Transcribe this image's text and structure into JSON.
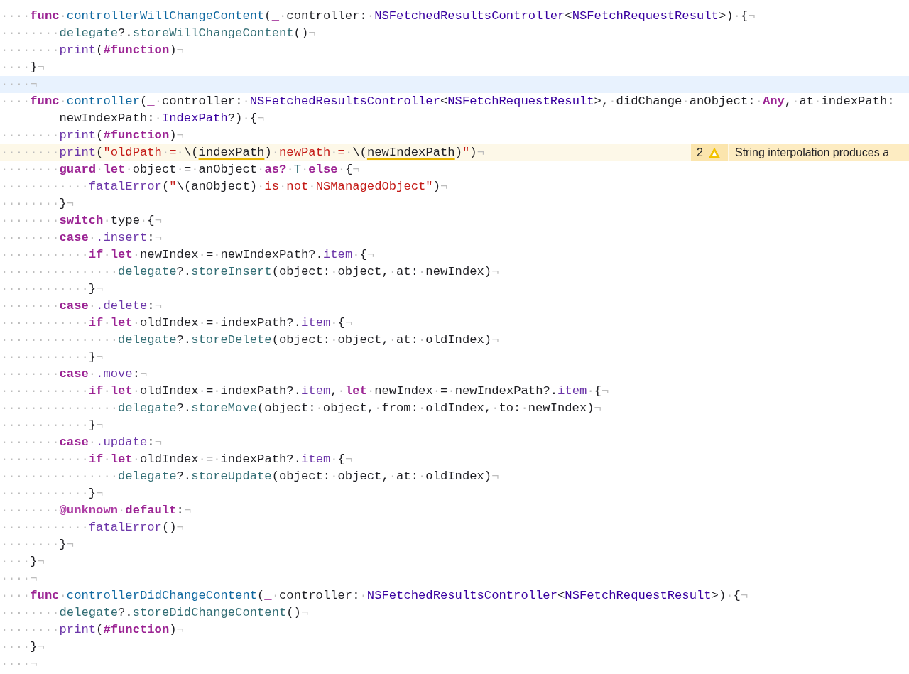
{
  "editor": {
    "lines": [
      {
        "current": false,
        "continuation": false,
        "tokens": [
          {
            "kind": "w",
            "text": "····"
          },
          {
            "kind": "k",
            "text": "func"
          },
          {
            "kind": "w",
            "text": "·"
          },
          {
            "kind": "d",
            "text": "controllerWillChangeContent"
          },
          {
            "kind": "p",
            "text": "("
          },
          {
            "kind": "k",
            "text": "_"
          },
          {
            "kind": "w",
            "text": "·"
          },
          {
            "kind": "p",
            "text": "controller:"
          },
          {
            "kind": "w",
            "text": "·"
          },
          {
            "kind": "st",
            "text": "NSFetchedResultsController"
          },
          {
            "kind": "p",
            "text": "<"
          },
          {
            "kind": "st",
            "text": "NSFetchRequestResult"
          },
          {
            "kind": "p",
            "text": ">)"
          },
          {
            "kind": "w",
            "text": "·"
          },
          {
            "kind": "p",
            "text": "{"
          },
          {
            "kind": "w",
            "text": "¬"
          }
        ]
      },
      {
        "current": false,
        "continuation": false,
        "tokens": [
          {
            "kind": "w",
            "text": "········"
          },
          {
            "kind": "pf",
            "text": "delegate"
          },
          {
            "kind": "p",
            "text": "?."
          },
          {
            "kind": "pf",
            "text": "storeWillChangeContent"
          },
          {
            "kind": "p",
            "text": "()"
          },
          {
            "kind": "w",
            "text": "¬"
          }
        ]
      },
      {
        "current": false,
        "continuation": false,
        "tokens": [
          {
            "kind": "w",
            "text": "········"
          },
          {
            "kind": "sf",
            "text": "print"
          },
          {
            "kind": "p",
            "text": "("
          },
          {
            "kind": "k",
            "text": "#function"
          },
          {
            "kind": "p",
            "text": ")"
          },
          {
            "kind": "w",
            "text": "¬"
          }
        ]
      },
      {
        "current": false,
        "continuation": false,
        "tokens": [
          {
            "kind": "w",
            "text": "····"
          },
          {
            "kind": "p",
            "text": "}"
          },
          {
            "kind": "w",
            "text": "¬"
          }
        ]
      },
      {
        "current": true,
        "continuation": false,
        "tokens": [
          {
            "kind": "w",
            "text": "····¬"
          }
        ]
      },
      {
        "current": false,
        "continuation": false,
        "tokens": [
          {
            "kind": "w",
            "text": "····"
          },
          {
            "kind": "k",
            "text": "func"
          },
          {
            "kind": "w",
            "text": "·"
          },
          {
            "kind": "d",
            "text": "controller"
          },
          {
            "kind": "p",
            "text": "("
          },
          {
            "kind": "k",
            "text": "_"
          },
          {
            "kind": "w",
            "text": "·"
          },
          {
            "kind": "p",
            "text": "controller:"
          },
          {
            "kind": "w",
            "text": "·"
          },
          {
            "kind": "st",
            "text": "NSFetchedResultsController"
          },
          {
            "kind": "p",
            "text": "<"
          },
          {
            "kind": "st",
            "text": "NSFetchRequestResult"
          },
          {
            "kind": "p",
            "text": ">,"
          },
          {
            "kind": "w",
            "text": "·"
          },
          {
            "kind": "p",
            "text": "didChange"
          },
          {
            "kind": "w",
            "text": "·"
          },
          {
            "kind": "p",
            "text": "anObject:"
          },
          {
            "kind": "w",
            "text": "·"
          },
          {
            "kind": "k",
            "text": "Any"
          },
          {
            "kind": "p",
            "text": ","
          },
          {
            "kind": "w",
            "text": "·"
          },
          {
            "kind": "p",
            "text": "at"
          },
          {
            "kind": "w",
            "text": "·"
          },
          {
            "kind": "p",
            "text": "indexPath:"
          }
        ]
      },
      {
        "current": false,
        "continuation": true,
        "tokens": [
          {
            "kind": "p",
            "text": "newIndexPath:"
          },
          {
            "kind": "w",
            "text": "·"
          },
          {
            "kind": "st",
            "text": "IndexPath"
          },
          {
            "kind": "p",
            "text": "?)"
          },
          {
            "kind": "w",
            "text": "·"
          },
          {
            "kind": "p",
            "text": "{"
          },
          {
            "kind": "w",
            "text": "¬"
          }
        ]
      },
      {
        "current": false,
        "continuation": false,
        "tokens": [
          {
            "kind": "w",
            "text": "········"
          },
          {
            "kind": "sf",
            "text": "print"
          },
          {
            "kind": "p",
            "text": "("
          },
          {
            "kind": "k",
            "text": "#function"
          },
          {
            "kind": "p",
            "text": ")"
          },
          {
            "kind": "w",
            "text": "¬"
          }
        ]
      },
      {
        "current": false,
        "continuation": false,
        "warning": {
          "count": "2",
          "message": "String interpolation produces a"
        },
        "tokens": [
          {
            "kind": "w",
            "text": "········"
          },
          {
            "kind": "sf",
            "text": "print"
          },
          {
            "kind": "p",
            "text": "("
          },
          {
            "kind": "s",
            "text": "\"oldPath"
          },
          {
            "kind": "w",
            "text": "·"
          },
          {
            "kind": "s",
            "text": "="
          },
          {
            "kind": "w",
            "text": "·"
          },
          {
            "kind": "p",
            "text": "\\("
          },
          {
            "kind": "u",
            "text": "indexPath"
          },
          {
            "kind": "p",
            "text": ")"
          },
          {
            "kind": "w",
            "text": "·"
          },
          {
            "kind": "s",
            "text": "newPath"
          },
          {
            "kind": "w",
            "text": "·"
          },
          {
            "kind": "s",
            "text": "="
          },
          {
            "kind": "w",
            "text": "·"
          },
          {
            "kind": "p",
            "text": "\\("
          },
          {
            "kind": "u",
            "text": "newIndexPath"
          },
          {
            "kind": "p",
            "text": ")"
          },
          {
            "kind": "s",
            "text": "\""
          },
          {
            "kind": "p",
            "text": ")"
          },
          {
            "kind": "w",
            "text": "¬"
          }
        ]
      },
      {
        "current": false,
        "continuation": false,
        "tokens": [
          {
            "kind": "w",
            "text": "········"
          },
          {
            "kind": "k",
            "text": "guard"
          },
          {
            "kind": "w",
            "text": "·"
          },
          {
            "kind": "k",
            "text": "let"
          },
          {
            "kind": "w",
            "text": "·"
          },
          {
            "kind": "p",
            "text": "object"
          },
          {
            "kind": "w",
            "text": "·"
          },
          {
            "kind": "p",
            "text": "="
          },
          {
            "kind": "w",
            "text": "·"
          },
          {
            "kind": "p",
            "text": "anObject"
          },
          {
            "kind": "w",
            "text": "·"
          },
          {
            "kind": "k",
            "text": "as?"
          },
          {
            "kind": "w",
            "text": "·"
          },
          {
            "kind": "pf",
            "text": "T"
          },
          {
            "kind": "w",
            "text": "·"
          },
          {
            "kind": "k",
            "text": "else"
          },
          {
            "kind": "w",
            "text": "·"
          },
          {
            "kind": "p",
            "text": "{"
          },
          {
            "kind": "w",
            "text": "¬"
          }
        ]
      },
      {
        "current": false,
        "continuation": false,
        "tokens": [
          {
            "kind": "w",
            "text": "············"
          },
          {
            "kind": "sf",
            "text": "fatalError"
          },
          {
            "kind": "p",
            "text": "("
          },
          {
            "kind": "s",
            "text": "\""
          },
          {
            "kind": "p",
            "text": "\\(anObject)"
          },
          {
            "kind": "w",
            "text": "·"
          },
          {
            "kind": "s",
            "text": "is"
          },
          {
            "kind": "w",
            "text": "·"
          },
          {
            "kind": "s",
            "text": "not"
          },
          {
            "kind": "w",
            "text": "·"
          },
          {
            "kind": "s",
            "text": "NSManagedObject\""
          },
          {
            "kind": "p",
            "text": ")"
          },
          {
            "kind": "w",
            "text": "¬"
          }
        ]
      },
      {
        "current": false,
        "continuation": false,
        "tokens": [
          {
            "kind": "w",
            "text": "········"
          },
          {
            "kind": "p",
            "text": "}"
          },
          {
            "kind": "w",
            "text": "¬"
          }
        ]
      },
      {
        "current": false,
        "continuation": false,
        "tokens": [
          {
            "kind": "w",
            "text": "········"
          },
          {
            "kind": "k",
            "text": "switch"
          },
          {
            "kind": "w",
            "text": "·"
          },
          {
            "kind": "p",
            "text": "type"
          },
          {
            "kind": "w",
            "text": "·"
          },
          {
            "kind": "p",
            "text": "{"
          },
          {
            "kind": "w",
            "text": "¬"
          }
        ]
      },
      {
        "current": false,
        "continuation": false,
        "tokens": [
          {
            "kind": "w",
            "text": "········"
          },
          {
            "kind": "k",
            "text": "case"
          },
          {
            "kind": "w",
            "text": "·"
          },
          {
            "kind": "sf",
            "text": ".insert"
          },
          {
            "kind": "p",
            "text": ":"
          },
          {
            "kind": "w",
            "text": "¬"
          }
        ]
      },
      {
        "current": false,
        "continuation": false,
        "tokens": [
          {
            "kind": "w",
            "text": "············"
          },
          {
            "kind": "k",
            "text": "if"
          },
          {
            "kind": "w",
            "text": "·"
          },
          {
            "kind": "k",
            "text": "let"
          },
          {
            "kind": "w",
            "text": "·"
          },
          {
            "kind": "p",
            "text": "newIndex"
          },
          {
            "kind": "w",
            "text": "·"
          },
          {
            "kind": "p",
            "text": "="
          },
          {
            "kind": "w",
            "text": "·"
          },
          {
            "kind": "p",
            "text": "newIndexPath?."
          },
          {
            "kind": "sf",
            "text": "item"
          },
          {
            "kind": "w",
            "text": "·"
          },
          {
            "kind": "p",
            "text": "{"
          },
          {
            "kind": "w",
            "text": "¬"
          }
        ]
      },
      {
        "current": false,
        "continuation": false,
        "tokens": [
          {
            "kind": "w",
            "text": "················"
          },
          {
            "kind": "pf",
            "text": "delegate"
          },
          {
            "kind": "p",
            "text": "?."
          },
          {
            "kind": "pf",
            "text": "storeInsert"
          },
          {
            "kind": "p",
            "text": "(object:"
          },
          {
            "kind": "w",
            "text": "·"
          },
          {
            "kind": "p",
            "text": "object,"
          },
          {
            "kind": "w",
            "text": "·"
          },
          {
            "kind": "p",
            "text": "at:"
          },
          {
            "kind": "w",
            "text": "·"
          },
          {
            "kind": "p",
            "text": "newIndex)"
          },
          {
            "kind": "w",
            "text": "¬"
          }
        ]
      },
      {
        "current": false,
        "continuation": false,
        "tokens": [
          {
            "kind": "w",
            "text": "············"
          },
          {
            "kind": "p",
            "text": "}"
          },
          {
            "kind": "w",
            "text": "¬"
          }
        ]
      },
      {
        "current": false,
        "continuation": false,
        "tokens": [
          {
            "kind": "w",
            "text": "········"
          },
          {
            "kind": "k",
            "text": "case"
          },
          {
            "kind": "w",
            "text": "·"
          },
          {
            "kind": "sf",
            "text": ".delete"
          },
          {
            "kind": "p",
            "text": ":"
          },
          {
            "kind": "w",
            "text": "¬"
          }
        ]
      },
      {
        "current": false,
        "continuation": false,
        "tokens": [
          {
            "kind": "w",
            "text": "············"
          },
          {
            "kind": "k",
            "text": "if"
          },
          {
            "kind": "w",
            "text": "·"
          },
          {
            "kind": "k",
            "text": "let"
          },
          {
            "kind": "w",
            "text": "·"
          },
          {
            "kind": "p",
            "text": "oldIndex"
          },
          {
            "kind": "w",
            "text": "·"
          },
          {
            "kind": "p",
            "text": "="
          },
          {
            "kind": "w",
            "text": "·"
          },
          {
            "kind": "p",
            "text": "indexPath?."
          },
          {
            "kind": "sf",
            "text": "item"
          },
          {
            "kind": "w",
            "text": "·"
          },
          {
            "kind": "p",
            "text": "{"
          },
          {
            "kind": "w",
            "text": "¬"
          }
        ]
      },
      {
        "current": false,
        "continuation": false,
        "tokens": [
          {
            "kind": "w",
            "text": "················"
          },
          {
            "kind": "pf",
            "text": "delegate"
          },
          {
            "kind": "p",
            "text": "?."
          },
          {
            "kind": "pf",
            "text": "storeDelete"
          },
          {
            "kind": "p",
            "text": "(object:"
          },
          {
            "kind": "w",
            "text": "·"
          },
          {
            "kind": "p",
            "text": "object,"
          },
          {
            "kind": "w",
            "text": "·"
          },
          {
            "kind": "p",
            "text": "at:"
          },
          {
            "kind": "w",
            "text": "·"
          },
          {
            "kind": "p",
            "text": "oldIndex)"
          },
          {
            "kind": "w",
            "text": "¬"
          }
        ]
      },
      {
        "current": false,
        "continuation": false,
        "tokens": [
          {
            "kind": "w",
            "text": "············"
          },
          {
            "kind": "p",
            "text": "}"
          },
          {
            "kind": "w",
            "text": "¬"
          }
        ]
      },
      {
        "current": false,
        "continuation": false,
        "tokens": [
          {
            "kind": "w",
            "text": "········"
          },
          {
            "kind": "k",
            "text": "case"
          },
          {
            "kind": "w",
            "text": "·"
          },
          {
            "kind": "sf",
            "text": ".move"
          },
          {
            "kind": "p",
            "text": ":"
          },
          {
            "kind": "w",
            "text": "¬"
          }
        ]
      },
      {
        "current": false,
        "continuation": false,
        "tokens": [
          {
            "kind": "w",
            "text": "············"
          },
          {
            "kind": "k",
            "text": "if"
          },
          {
            "kind": "w",
            "text": "·"
          },
          {
            "kind": "k",
            "text": "let"
          },
          {
            "kind": "w",
            "text": "·"
          },
          {
            "kind": "p",
            "text": "oldIndex"
          },
          {
            "kind": "w",
            "text": "·"
          },
          {
            "kind": "p",
            "text": "="
          },
          {
            "kind": "w",
            "text": "·"
          },
          {
            "kind": "p",
            "text": "indexPath?."
          },
          {
            "kind": "sf",
            "text": "item"
          },
          {
            "kind": "p",
            "text": ","
          },
          {
            "kind": "w",
            "text": "·"
          },
          {
            "kind": "k",
            "text": "let"
          },
          {
            "kind": "w",
            "text": "·"
          },
          {
            "kind": "p",
            "text": "newIndex"
          },
          {
            "kind": "w",
            "text": "·"
          },
          {
            "kind": "p",
            "text": "="
          },
          {
            "kind": "w",
            "text": "·"
          },
          {
            "kind": "p",
            "text": "newIndexPath?."
          },
          {
            "kind": "sf",
            "text": "item"
          },
          {
            "kind": "w",
            "text": "·"
          },
          {
            "kind": "p",
            "text": "{"
          },
          {
            "kind": "w",
            "text": "¬"
          }
        ]
      },
      {
        "current": false,
        "continuation": false,
        "tokens": [
          {
            "kind": "w",
            "text": "················"
          },
          {
            "kind": "pf",
            "text": "delegate"
          },
          {
            "kind": "p",
            "text": "?."
          },
          {
            "kind": "pf",
            "text": "storeMove"
          },
          {
            "kind": "p",
            "text": "(object:"
          },
          {
            "kind": "w",
            "text": "·"
          },
          {
            "kind": "p",
            "text": "object,"
          },
          {
            "kind": "w",
            "text": "·"
          },
          {
            "kind": "p",
            "text": "from:"
          },
          {
            "kind": "w",
            "text": "·"
          },
          {
            "kind": "p",
            "text": "oldIndex,"
          },
          {
            "kind": "w",
            "text": "·"
          },
          {
            "kind": "p",
            "text": "to:"
          },
          {
            "kind": "w",
            "text": "·"
          },
          {
            "kind": "p",
            "text": "newIndex)"
          },
          {
            "kind": "w",
            "text": "¬"
          }
        ]
      },
      {
        "current": false,
        "continuation": false,
        "tokens": [
          {
            "kind": "w",
            "text": "············"
          },
          {
            "kind": "p",
            "text": "}"
          },
          {
            "kind": "w",
            "text": "¬"
          }
        ]
      },
      {
        "current": false,
        "continuation": false,
        "tokens": [
          {
            "kind": "w",
            "text": "········"
          },
          {
            "kind": "k",
            "text": "case"
          },
          {
            "kind": "w",
            "text": "·"
          },
          {
            "kind": "sf",
            "text": ".update"
          },
          {
            "kind": "p",
            "text": ":"
          },
          {
            "kind": "w",
            "text": "¬"
          }
        ]
      },
      {
        "current": false,
        "continuation": false,
        "tokens": [
          {
            "kind": "w",
            "text": "············"
          },
          {
            "kind": "k",
            "text": "if"
          },
          {
            "kind": "w",
            "text": "·"
          },
          {
            "kind": "k",
            "text": "let"
          },
          {
            "kind": "w",
            "text": "·"
          },
          {
            "kind": "p",
            "text": "oldIndex"
          },
          {
            "kind": "w",
            "text": "·"
          },
          {
            "kind": "p",
            "text": "="
          },
          {
            "kind": "w",
            "text": "·"
          },
          {
            "kind": "p",
            "text": "indexPath?."
          },
          {
            "kind": "sf",
            "text": "item"
          },
          {
            "kind": "w",
            "text": "·"
          },
          {
            "kind": "p",
            "text": "{"
          },
          {
            "kind": "w",
            "text": "¬"
          }
        ]
      },
      {
        "current": false,
        "continuation": false,
        "tokens": [
          {
            "kind": "w",
            "text": "················"
          },
          {
            "kind": "pf",
            "text": "delegate"
          },
          {
            "kind": "p",
            "text": "?."
          },
          {
            "kind": "pf",
            "text": "storeUpdate"
          },
          {
            "kind": "p",
            "text": "(object:"
          },
          {
            "kind": "w",
            "text": "·"
          },
          {
            "kind": "p",
            "text": "object,"
          },
          {
            "kind": "w",
            "text": "·"
          },
          {
            "kind": "p",
            "text": "at:"
          },
          {
            "kind": "w",
            "text": "·"
          },
          {
            "kind": "p",
            "text": "oldIndex)"
          },
          {
            "kind": "w",
            "text": "¬"
          }
        ]
      },
      {
        "current": false,
        "continuation": false,
        "tokens": [
          {
            "kind": "w",
            "text": "············"
          },
          {
            "kind": "p",
            "text": "}"
          },
          {
            "kind": "w",
            "text": "¬"
          }
        ]
      },
      {
        "current": false,
        "continuation": false,
        "tokens": [
          {
            "kind": "w",
            "text": "········"
          },
          {
            "kind": "a",
            "text": "@unknown"
          },
          {
            "kind": "w",
            "text": "·"
          },
          {
            "kind": "k",
            "text": "default"
          },
          {
            "kind": "p",
            "text": ":"
          },
          {
            "kind": "w",
            "text": "¬"
          }
        ]
      },
      {
        "current": false,
        "continuation": false,
        "tokens": [
          {
            "kind": "w",
            "text": "············"
          },
          {
            "kind": "sf",
            "text": "fatalError"
          },
          {
            "kind": "p",
            "text": "()"
          },
          {
            "kind": "w",
            "text": "¬"
          }
        ]
      },
      {
        "current": false,
        "continuation": false,
        "tokens": [
          {
            "kind": "w",
            "text": "········"
          },
          {
            "kind": "p",
            "text": "}"
          },
          {
            "kind": "w",
            "text": "¬"
          }
        ]
      },
      {
        "current": false,
        "continuation": false,
        "tokens": [
          {
            "kind": "w",
            "text": "····"
          },
          {
            "kind": "p",
            "text": "}"
          },
          {
            "kind": "w",
            "text": "¬"
          }
        ]
      },
      {
        "current": false,
        "continuation": false,
        "tokens": [
          {
            "kind": "w",
            "text": "····¬"
          }
        ]
      },
      {
        "current": false,
        "continuation": false,
        "tokens": [
          {
            "kind": "w",
            "text": "····"
          },
          {
            "kind": "k",
            "text": "func"
          },
          {
            "kind": "w",
            "text": "·"
          },
          {
            "kind": "d",
            "text": "controllerDidChangeContent"
          },
          {
            "kind": "p",
            "text": "("
          },
          {
            "kind": "k",
            "text": "_"
          },
          {
            "kind": "w",
            "text": "·"
          },
          {
            "kind": "p",
            "text": "controller:"
          },
          {
            "kind": "w",
            "text": "·"
          },
          {
            "kind": "st",
            "text": "NSFetchedResultsController"
          },
          {
            "kind": "p",
            "text": "<"
          },
          {
            "kind": "st",
            "text": "NSFetchRequestResult"
          },
          {
            "kind": "p",
            "text": ">)"
          },
          {
            "kind": "w",
            "text": "·"
          },
          {
            "kind": "p",
            "text": "{"
          },
          {
            "kind": "w",
            "text": "¬"
          }
        ]
      },
      {
        "current": false,
        "continuation": false,
        "tokens": [
          {
            "kind": "w",
            "text": "········"
          },
          {
            "kind": "pf",
            "text": "delegate"
          },
          {
            "kind": "p",
            "text": "?."
          },
          {
            "kind": "pf",
            "text": "storeDidChangeContent"
          },
          {
            "kind": "p",
            "text": "()"
          },
          {
            "kind": "w",
            "text": "¬"
          }
        ]
      },
      {
        "current": false,
        "continuation": false,
        "tokens": [
          {
            "kind": "w",
            "text": "········"
          },
          {
            "kind": "sf",
            "text": "print"
          },
          {
            "kind": "p",
            "text": "("
          },
          {
            "kind": "k",
            "text": "#function"
          },
          {
            "kind": "p",
            "text": ")"
          },
          {
            "kind": "w",
            "text": "¬"
          }
        ]
      },
      {
        "current": false,
        "continuation": false,
        "tokens": [
          {
            "kind": "w",
            "text": "····"
          },
          {
            "kind": "p",
            "text": "}"
          },
          {
            "kind": "w",
            "text": "¬"
          }
        ]
      },
      {
        "current": false,
        "continuation": false,
        "tokens": [
          {
            "kind": "w",
            "text": "····¬"
          }
        ]
      }
    ]
  }
}
